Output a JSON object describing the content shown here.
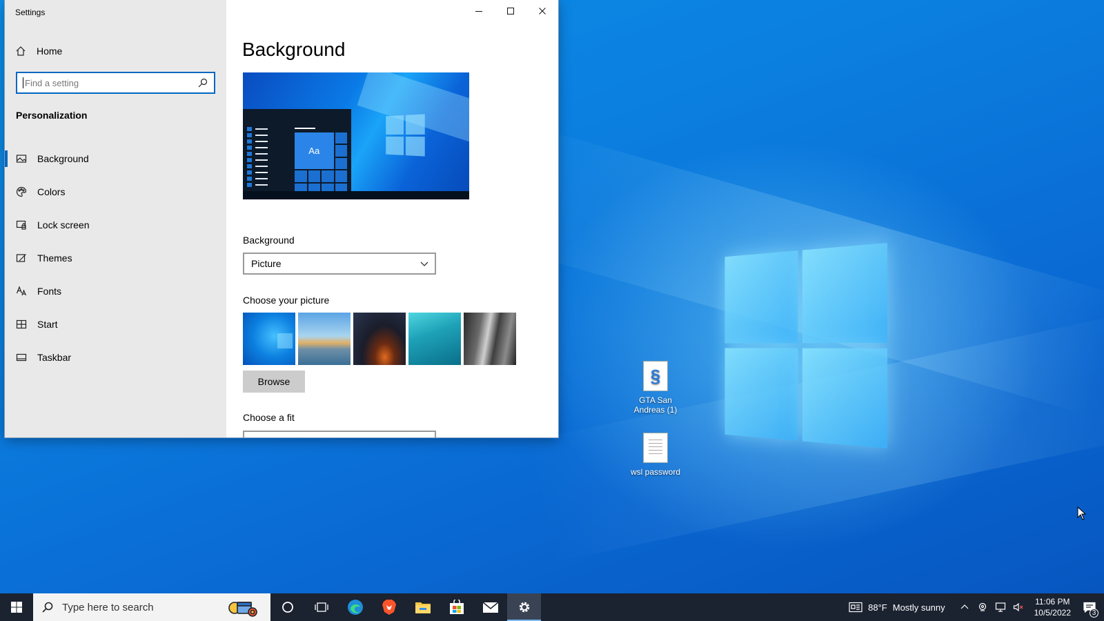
{
  "window": {
    "title": "Settings",
    "controls": {
      "minimize": "minimize",
      "maximize": "maximize",
      "close": "close"
    }
  },
  "sidebar": {
    "home_label": "Home",
    "search_placeholder": "Find a setting",
    "section_title": "Personalization",
    "items": [
      {
        "label": "Background",
        "icon": "picture-icon",
        "active": true
      },
      {
        "label": "Colors",
        "icon": "palette-icon",
        "active": false
      },
      {
        "label": "Lock screen",
        "icon": "lock-screen-icon",
        "active": false
      },
      {
        "label": "Themes",
        "icon": "themes-icon",
        "active": false
      },
      {
        "label": "Fonts",
        "icon": "fonts-icon",
        "active": false
      },
      {
        "label": "Start",
        "icon": "start-icon",
        "active": false
      },
      {
        "label": "Taskbar",
        "icon": "taskbar-icon",
        "active": false
      }
    ]
  },
  "main": {
    "title": "Background",
    "preview": {
      "tile_text": "Aa"
    },
    "background_label": "Background",
    "background_value": "Picture",
    "choose_picture_label": "Choose your picture",
    "browse_label": "Browse",
    "choose_fit_label": "Choose a fit"
  },
  "desktop": {
    "icons": [
      {
        "label": "GTA San Andreas (1)",
        "icon": "script-file-icon"
      },
      {
        "label": "wsl password",
        "icon": "text-file-icon"
      }
    ]
  },
  "taskbar": {
    "search_placeholder": "Type here to search",
    "apps": [
      "cortana-icon",
      "task-view-icon",
      "edge-icon",
      "brave-icon",
      "file-explorer-icon",
      "store-icon",
      "mail-icon",
      "settings-icon"
    ],
    "weather": {
      "temp": "88°F",
      "condition": "Mostly sunny"
    },
    "time": "11:06 PM",
    "date": "10/5/2022",
    "notification_count": "3"
  },
  "colors": {
    "accent": "#0067c0",
    "taskbar": "#1b2230",
    "sidebar": "#e9e9e9"
  }
}
